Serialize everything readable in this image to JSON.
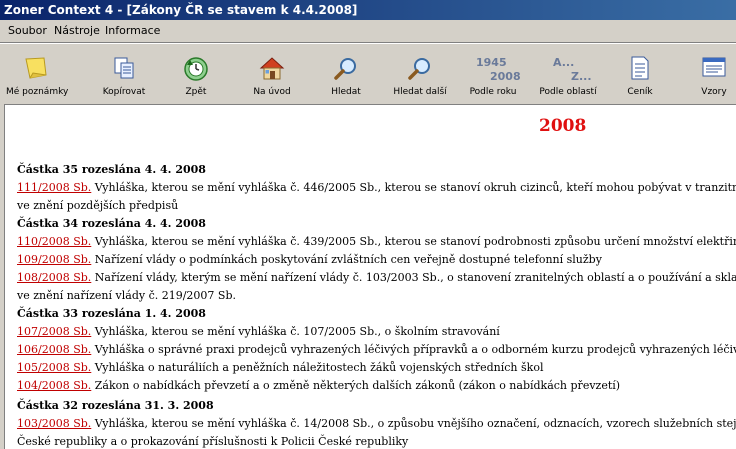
{
  "window": {
    "title": "Zoner Context 4 - [Zákony ČR se stavem k 4.4.2008]"
  },
  "menu": [
    {
      "label": "Soubor"
    },
    {
      "label": "Nástroje"
    },
    {
      "label": "Informace"
    }
  ],
  "toolbar": [
    {
      "label": "Mé poznámky",
      "icon": "note-icon"
    },
    {
      "label": "Kopírovat",
      "icon": "copy-icon"
    },
    {
      "label": "Zpět",
      "icon": "back-icon"
    },
    {
      "label": "Na úvod",
      "icon": "home-icon"
    },
    {
      "label": "Hledat",
      "icon": "search-icon"
    },
    {
      "label": "Hledat další",
      "icon": "search-next-icon"
    },
    {
      "label": "Podle roku",
      "icon": "year-icon",
      "icon_text_top": "1945",
      "icon_text_bottom": "2008"
    },
    {
      "label": "Podle oblastí",
      "icon": "area-icon",
      "icon_text_top": "A...",
      "icon_text_bottom": "Z..."
    },
    {
      "label": "Ceník",
      "icon": "pricelist-icon"
    },
    {
      "label": "Vzory",
      "icon": "templates-icon"
    }
  ],
  "content": {
    "year": "2008",
    "lines": [
      {
        "type": "head",
        "text": "Částka 35 rozeslána 4. 4. 2008"
      },
      {
        "type": "item",
        "link": "111/2008 Sb.",
        "text": " Vyhláška, kterou se mění vyhláška č. 446/2005 Sb., kterou se stanoví okruh cizinců, kteří mohou pobývat v tranzitním prosto"
      },
      {
        "type": "text",
        "text": "ve znění pozdějších předpisů"
      },
      {
        "type": "head",
        "text": "Částka 34 rozeslána 4. 4. 2008"
      },
      {
        "type": "item",
        "link": "110/2008 Sb.",
        "text": " Vyhláška, kterou se mění vyhláška č. 439/2005 Sb., kterou se stanoví podrobnosti způsobu určení množství elektřiny z kom"
      },
      {
        "type": "item",
        "link": "109/2008 Sb.",
        "text": " Nařízení vlády o podmínkách poskytování zvláštních cen veřejně dostupné telefonní služby"
      },
      {
        "type": "item",
        "link": "108/2008 Sb.",
        "text": " Nařízení vlády, kterým se mění nařízení vlády č. 103/2003 Sb., o stanovení zranitelných oblastí a o používání a skladování hn"
      },
      {
        "type": "text",
        "text": "ve znění nařízení vlády č. 219/2007 Sb."
      },
      {
        "type": "head",
        "text": "Částka 33 rozeslána 1. 4. 2008"
      },
      {
        "type": "item",
        "link": "107/2008 Sb.",
        "text": " Vyhláška, kterou se mění vyhláška č. 107/2005 Sb., o školním stravování"
      },
      {
        "type": "item",
        "link": "106/2008 Sb.",
        "text": " Vyhláška o správné praxi prodejců vyhrazených léčivých přípravků a o odborném kurzu prodejců vyhrazených léčivých při"
      },
      {
        "type": "item",
        "link": "105/2008 Sb.",
        "text": " Vyhláška o naturáliích a peněžních náležitostech žáků vojenských středních škol"
      },
      {
        "type": "item",
        "link": "104/2008 Sb.",
        "text": " Zákon o nabídkách převzetí a o změně některých dalších zákonů (zákon o nabídkách převzetí)"
      },
      {
        "type": "head",
        "text": "Částka 32 rozeslána 31. 3. 2008"
      },
      {
        "type": "item",
        "link": "103/2008 Sb.",
        "text": " Vyhláška, kterou se mění vyhláška č. 14/2008 Sb., o způsobu vnějšího označení, odznacích, vzorech služebních stejnokrojů"
      },
      {
        "type": "text",
        "text": "České republiky a o prokazování příslušnosti k Policii České republiky"
      }
    ]
  },
  "colors": {
    "link": "#c00000",
    "year": "#e01010",
    "titlebar_start": "#0a246a",
    "titlebar_end": "#3a6ea5"
  }
}
